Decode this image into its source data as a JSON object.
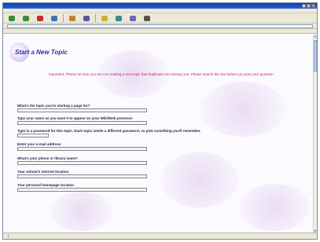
{
  "window": {
    "title": ""
  },
  "menu": [],
  "toolbar": [
    {
      "icon": "back-icon",
      "color": "#3a8a3a"
    },
    {
      "icon": "forward-icon",
      "color": "#3a8a3a"
    },
    {
      "icon": "stop-icon",
      "color": "#c03030"
    },
    {
      "icon": "refresh-icon",
      "color": "#3a70c0"
    },
    {
      "icon": "home-icon",
      "color": "#c08030"
    },
    {
      "icon": "search-icon",
      "color": "#5a5a9a"
    },
    {
      "icon": "favorites-icon",
      "color": "#d0b030"
    },
    {
      "icon": "history-icon",
      "color": "#3a8a8a"
    },
    {
      "icon": "mail-icon",
      "color": "#6a6ab0"
    },
    {
      "icon": "print-icon",
      "color": "#555555"
    }
  ],
  "address": {
    "label": "",
    "value": "",
    "go": ""
  },
  "links": [],
  "page": {
    "heading": "Start a New Topic",
    "notice": "Important: Please be sure you are not creating a new topic that duplicates an existing one. Please search the site before you post your question.",
    "intro": "",
    "questions": [
      {
        "label": "What's the topic you're starting a page for?",
        "value": "",
        "help": ""
      },
      {
        "label": "Type your name as you want it to appear on your Wiki/Web presence",
        "value": "",
        "help": ""
      },
      {
        "label": "Type in a password for this topic. Each topic needs a different password, so pick something you'll remember.",
        "value": "",
        "help": "",
        "short": true
      },
      {
        "label": "Enter your e-mail address",
        "value": "",
        "help": ""
      },
      {
        "label": "What's your phone or library name?",
        "value": "",
        "help": ""
      },
      {
        "label": "Your school's internet location",
        "value": "",
        "help": ""
      },
      {
        "label": "Your personal homepage location",
        "value": "",
        "help": ""
      }
    ]
  },
  "status": {
    "text": "",
    "zone": ""
  }
}
